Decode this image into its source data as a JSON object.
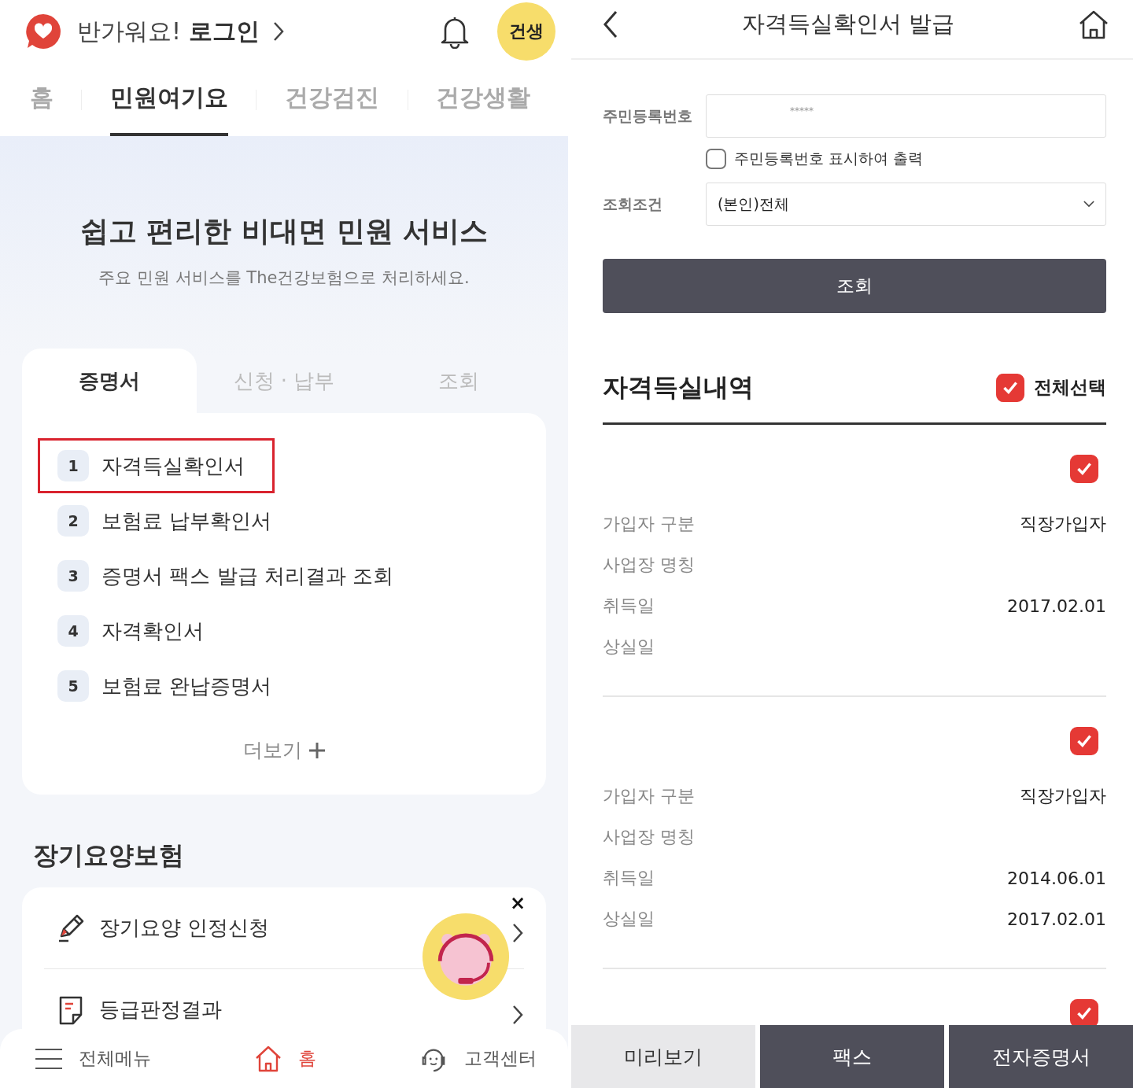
{
  "left": {
    "header": {
      "greeting": "반가워요!",
      "login": "로그인",
      "badge": "건생"
    },
    "nav_tabs": [
      {
        "label": "홈",
        "selected": false
      },
      {
        "label": "민원여기요",
        "selected": true
      },
      {
        "label": "건강검진",
        "selected": false
      },
      {
        "label": "건강생활",
        "selected": false
      }
    ],
    "hero": {
      "title": "쉽고 편리한 비대면 민원 서비스",
      "subtitle": "주요 민원 서비스를 The건강보험으로 처리하세요."
    },
    "service_tabs": [
      {
        "label": "증명서",
        "selected": true
      },
      {
        "label": "신청 · 납부",
        "selected": false
      },
      {
        "label": "조회",
        "selected": false
      }
    ],
    "services": [
      {
        "number": "1",
        "label": "자격득실확인서",
        "highlighted": true
      },
      {
        "number": "2",
        "label": "보험료 납부확인서",
        "highlighted": false
      },
      {
        "number": "3",
        "label": "증명서 팩스 발급 처리결과 조회",
        "highlighted": false
      },
      {
        "number": "4",
        "label": "자격확인서",
        "highlighted": false
      },
      {
        "number": "5",
        "label": "보험료 완납증명서",
        "highlighted": false
      }
    ],
    "more": "더보기",
    "section_title": "장기요양보험",
    "care_items": [
      {
        "label": "장기요양 인정신청",
        "kind": "pencil"
      },
      {
        "label": "등급판정결과",
        "kind": "document"
      }
    ],
    "chatbot": {
      "close": "×"
    },
    "bottom_nav": [
      {
        "label": "전체메뉴",
        "kind": "menu",
        "selected": false
      },
      {
        "label": "홈",
        "kind": "home",
        "selected": true
      },
      {
        "label": "고객센터",
        "kind": "support",
        "selected": false
      }
    ]
  },
  "right": {
    "header": {
      "title": "자격득실확인서 발급"
    },
    "form": {
      "id_label": "주민등록번호",
      "id_value": "*****",
      "show_id": {
        "label": "주민등록번호 표시하여 출력",
        "checked": false
      },
      "condition_label": "조회조건",
      "condition_value": "(본인)전체",
      "search_button": "조회"
    },
    "history": {
      "title": "자격득실내역",
      "select_all": {
        "label": "전체선택",
        "checked": true
      },
      "records": [
        {
          "checked": true,
          "rows": [
            {
              "label": "가입자 구분",
              "value": "직장가입자"
            },
            {
              "label": "사업장 명칭"
            },
            {
              "label": "취득일",
              "value": "2017.02.01"
            },
            {
              "label": "상실일"
            }
          ]
        },
        {
          "checked": true,
          "rows": [
            {
              "label": "가입자 구분",
              "value": "직장가입자"
            },
            {
              "label": "사업장 명칭"
            },
            {
              "label": "취득일",
              "value": "2014.06.01"
            },
            {
              "label": "상실일",
              "value": "2017.02.01"
            }
          ]
        },
        {
          "checked": true
        }
      ]
    },
    "actions": [
      {
        "label": "미리보기",
        "kind": "light"
      },
      {
        "label": "팩스",
        "kind": "dark"
      },
      {
        "label": "전자증명서",
        "kind": "dark"
      }
    ]
  }
}
